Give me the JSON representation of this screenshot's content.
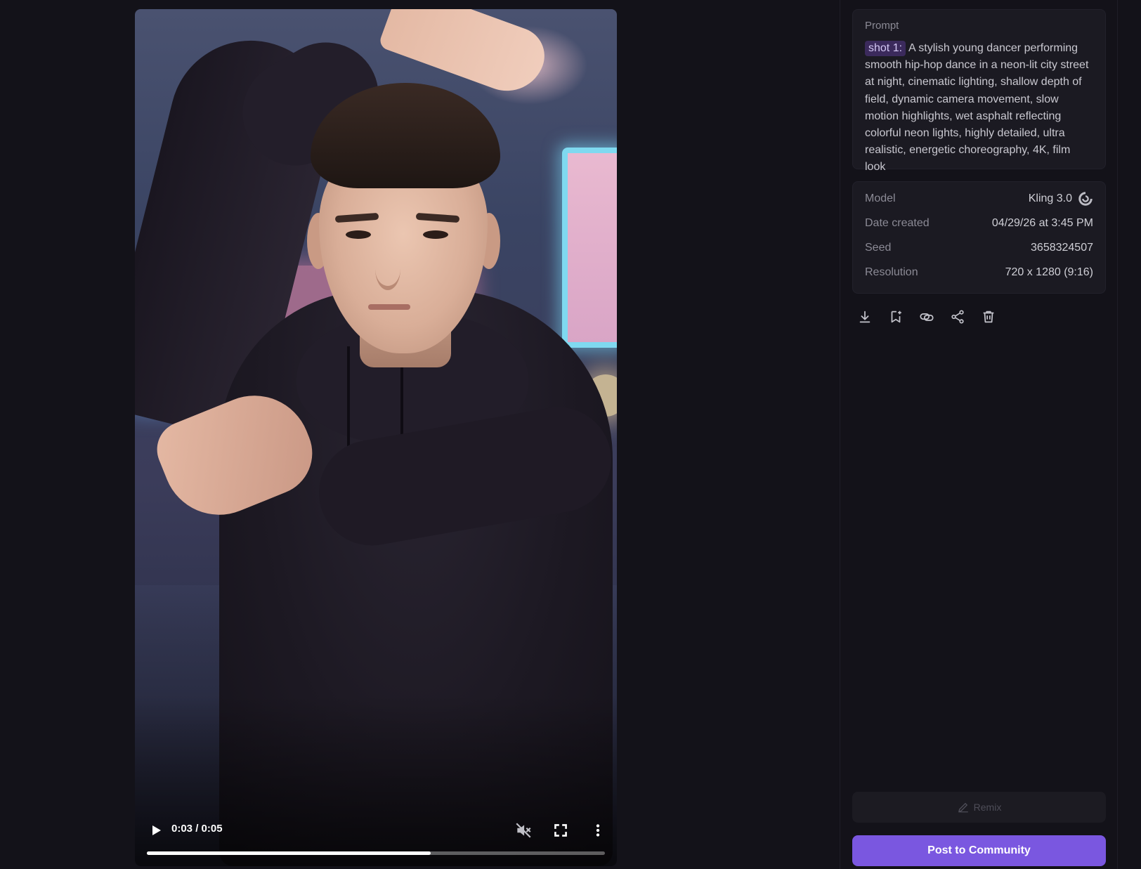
{
  "video": {
    "time_display": "0:03 / 0:05",
    "progress": 0.62,
    "icons": [
      "play-icon",
      "muted-icon",
      "fullscreen-icon",
      "more-vertical-icon"
    ]
  },
  "prompt": {
    "label": "Prompt",
    "shot_tag": "shot 1:",
    "text": "A stylish young dancer performing smooth hip-hop dance in a neon-lit city street at night, cinematic lighting, shallow depth of field, dynamic camera movement, slow motion highlights, wet asphalt reflecting colorful neon lights, highly detailed, ultra realistic, energetic choreography, 4K, film look"
  },
  "details": [
    {
      "label": "Model",
      "value": "Kling 3.0"
    },
    {
      "label": "Date created",
      "value": "04/29/26 at 3:45 PM"
    },
    {
      "label": "Seed",
      "value": "3658324507"
    },
    {
      "label": "Resolution",
      "value": "720 x 1280 (9:16)"
    }
  ],
  "actions": [
    "download-icon",
    "bookmark-add-icon",
    "link-icon",
    "share-icon",
    "trash-icon"
  ],
  "buttons": {
    "remix": "Remix",
    "post": "Post to Community"
  },
  "colors": {
    "background": "#131219",
    "accent": "#7a57e0",
    "shot_tag_bg": "#3b2a5c"
  }
}
